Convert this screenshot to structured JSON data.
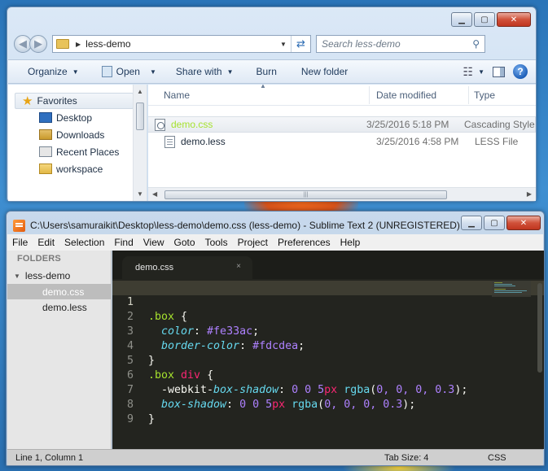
{
  "explorer": {
    "address": {
      "path": "less-demo"
    },
    "search": {
      "placeholder": "Search less-demo"
    },
    "toolbar": {
      "organize": "Organize",
      "open": "Open",
      "share_with": "Share with",
      "burn": "Burn",
      "new_folder": "New folder"
    },
    "nav": {
      "favorites": "Favorites",
      "items": [
        {
          "label": "Desktop",
          "icon": "desktop-icon"
        },
        {
          "label": "Downloads",
          "icon": "downloads-icon"
        },
        {
          "label": "Recent Places",
          "icon": "recent-places-icon"
        },
        {
          "label": "workspace",
          "icon": "folder-icon"
        }
      ]
    },
    "columns": {
      "name": "Name",
      "date": "Date modified",
      "type": "Type"
    },
    "files": [
      {
        "name": "demo.css",
        "date": "3/25/2016 5:18 PM",
        "type": "Cascading Style"
      },
      {
        "name": "demo.less",
        "date": "3/25/2016 4:58 PM",
        "type": "LESS File"
      }
    ]
  },
  "sublime": {
    "title": "C:\\Users\\samuraikit\\Desktop\\less-demo\\demo.css (less-demo) - Sublime Text 2 (UNREGISTERED)",
    "menu": [
      "File",
      "Edit",
      "Selection",
      "Find",
      "View",
      "Goto",
      "Tools",
      "Project",
      "Preferences",
      "Help"
    ],
    "sidebar": {
      "heading": "FOLDERS",
      "folder": "less-demo",
      "files": [
        "demo.css",
        "demo.less"
      ]
    },
    "tab": {
      "label": "demo.css",
      "close": "×"
    },
    "line_numbers": [
      "1",
      "2",
      "3",
      "4",
      "5",
      "6",
      "7",
      "8",
      "9"
    ],
    "code": {
      "l1": {
        "sel": ".box",
        "rest": " {"
      },
      "l2": {
        "prop": "color",
        "colon": ": ",
        "val": "#fe33ac",
        "semi": ";"
      },
      "l3": {
        "prop": "border-color",
        "colon": ": ",
        "val": "#fdcdea",
        "semi": ";"
      },
      "l4": "}",
      "l5": {
        "sel": ".box",
        "space": " ",
        "tag": "div",
        "rest": " {"
      },
      "l6": {
        "prefix": "-webkit-",
        "prop": "box-shadow",
        "colon": ": ",
        "v1": "0 0 5",
        "u1": "px",
        "fn": "rgba",
        "open": "(",
        "v2": "0, 0, 0, 0.3",
        "close": ");"
      },
      "l7": {
        "prop": "box-shadow",
        "colon": ": ",
        "v1": "0 0 5",
        "u1": "px",
        "fn": "rgba",
        "open": "(",
        "v2": "0, 0, 0, 0.3",
        "close": ");"
      },
      "l8": "}"
    },
    "status": {
      "position": "Line 1, Column 1",
      "tab_size": "Tab Size: 4",
      "syntax": "CSS"
    }
  }
}
